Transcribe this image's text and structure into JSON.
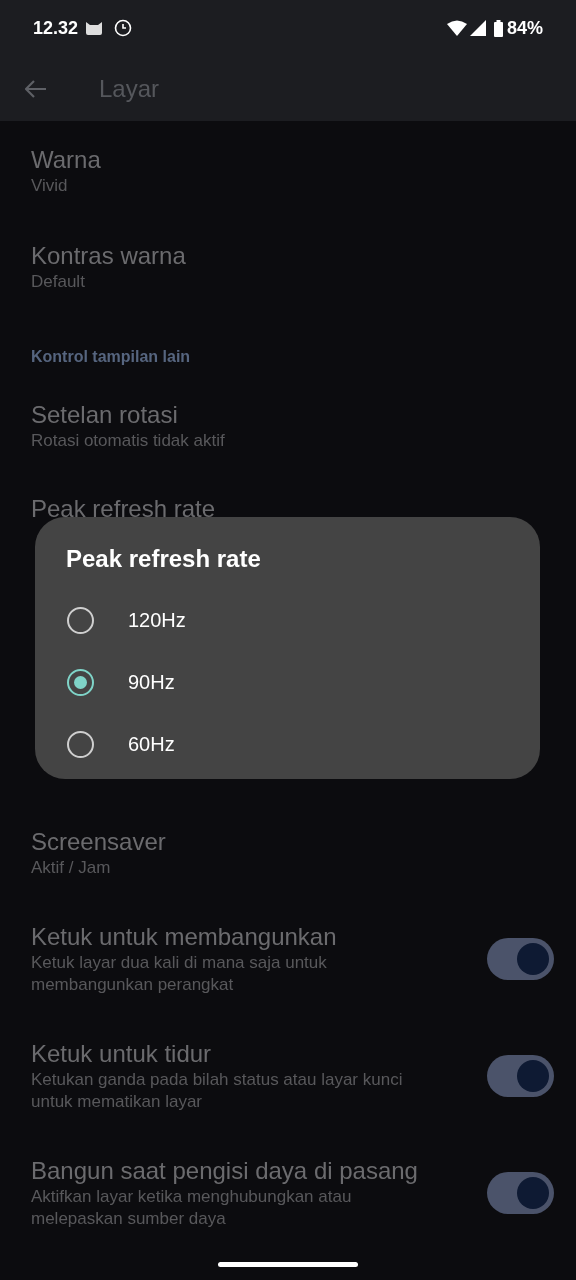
{
  "status_bar": {
    "time": "12.32",
    "battery": "84%"
  },
  "app_bar": {
    "title": "Layar"
  },
  "items": [
    {
      "kind": "nav",
      "title": "Warna",
      "subtitle": "Vivid"
    },
    {
      "kind": "nav",
      "title": "Kontras warna",
      "subtitle": "Default"
    },
    {
      "kind": "header",
      "title": "Kontrol tampilan lain"
    },
    {
      "kind": "nav",
      "title": "Setelan rotasi",
      "subtitle": "Rotasi otomatis tidak aktif"
    },
    {
      "kind": "covered",
      "title": "Peak refresh rate"
    },
    {
      "kind": "nav",
      "title": "Screensaver",
      "subtitle": "Aktif / Jam"
    },
    {
      "kind": "switch",
      "title": "Ketuk untuk membangunkan",
      "subtitle": "Ketuk layar dua kali di mana saja untuk membangunkan perangkat",
      "on": true
    },
    {
      "kind": "switch",
      "title": "Ketuk untuk tidur",
      "subtitle": "Ketukan ganda pada bilah status atau layar kunci untuk mematikan layar",
      "on": true
    },
    {
      "kind": "switch",
      "title": "Bangun saat pengisi daya di pasang",
      "subtitle": "Aktifkan layar ketika menghubungkan atau melepaskan sumber daya",
      "on": true
    }
  ],
  "dialog": {
    "title": "Peak refresh rate",
    "options": [
      {
        "label": "120Hz",
        "selected": false
      },
      {
        "label": "90Hz",
        "selected": true
      },
      {
        "label": "60Hz",
        "selected": false
      }
    ]
  }
}
